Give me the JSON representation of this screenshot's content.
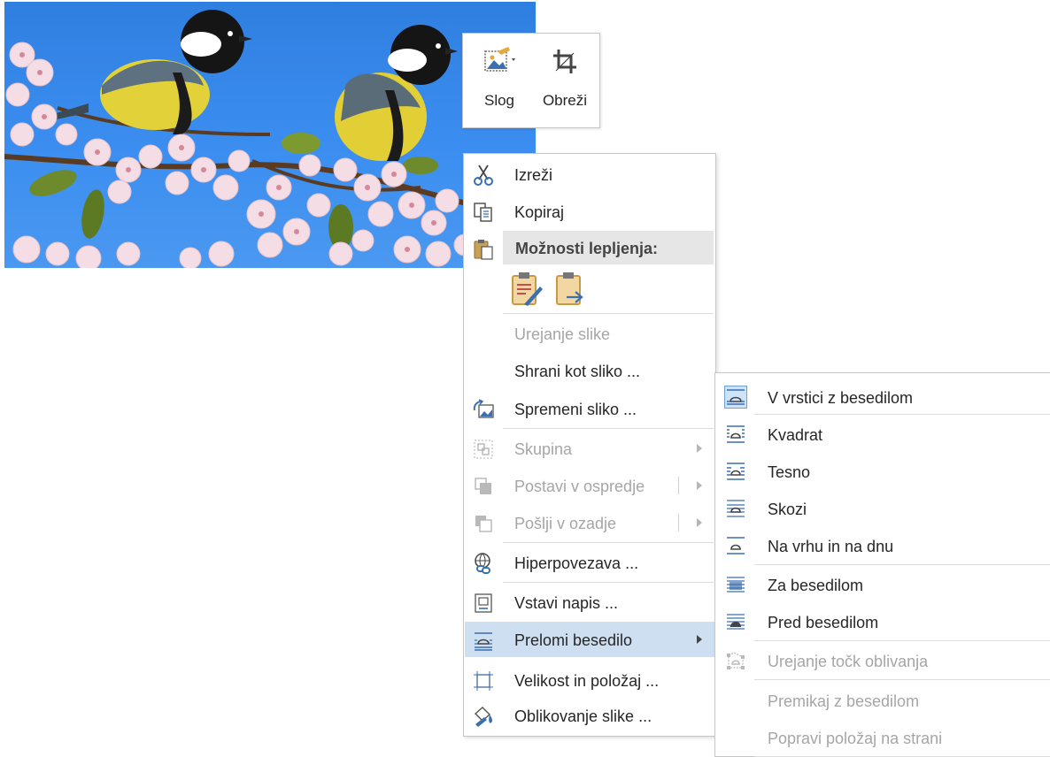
{
  "mini_toolbar": {
    "style_label": "Slog",
    "crop_label": "Obreži"
  },
  "context_menu": {
    "cut": "Izreži",
    "copy": "Kopiraj",
    "paste_options_header": "Možnosti lepljenja:",
    "edit_picture": "Urejanje slike",
    "save_as_picture": "Shrani kot sliko ...",
    "change_picture": "Spremeni sliko ...",
    "group": "Skupina",
    "bring_to_front": "Postavi v ospredje",
    "send_to_back": "Pošlji v ozadje",
    "hyperlink": "Hiperpovezava ...",
    "insert_caption": "Vstavi napis ...",
    "wrap_text": "Prelomi besedilo",
    "size_position": "Velikost in položaj ...",
    "format_picture": "Oblikovanje slike ..."
  },
  "wrap_submenu": {
    "in_line": "V vrstici z besedilom",
    "square": "Kvadrat",
    "tight": "Tesno",
    "through": "Skozi",
    "top_bottom": "Na vrhu in na dnu",
    "behind": "Za besedilom",
    "in_front": "Pred besedilom",
    "edit_wrap_points": "Urejanje točk oblivanja",
    "move_with_text": "Premikaj z besedilom",
    "fix_position": "Popravi položaj na strani"
  },
  "colors": {
    "icon_blue": "#3a6fb0",
    "highlight": "#cfdff2",
    "disabled_text": "#a6a6a6"
  }
}
